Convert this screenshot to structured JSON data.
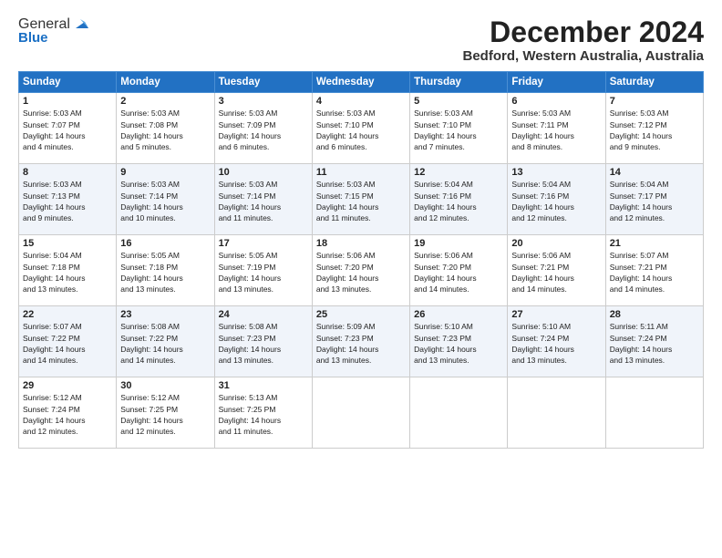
{
  "logo": {
    "general": "General",
    "blue": "Blue"
  },
  "title": "December 2024",
  "location": "Bedford, Western Australia, Australia",
  "headers": [
    "Sunday",
    "Monday",
    "Tuesday",
    "Wednesday",
    "Thursday",
    "Friday",
    "Saturday"
  ],
  "weeks": [
    [
      {
        "day": "1",
        "info": "Sunrise: 5:03 AM\nSunset: 7:07 PM\nDaylight: 14 hours\nand 4 minutes."
      },
      {
        "day": "2",
        "info": "Sunrise: 5:03 AM\nSunset: 7:08 PM\nDaylight: 14 hours\nand 5 minutes."
      },
      {
        "day": "3",
        "info": "Sunrise: 5:03 AM\nSunset: 7:09 PM\nDaylight: 14 hours\nand 6 minutes."
      },
      {
        "day": "4",
        "info": "Sunrise: 5:03 AM\nSunset: 7:10 PM\nDaylight: 14 hours\nand 6 minutes."
      },
      {
        "day": "5",
        "info": "Sunrise: 5:03 AM\nSunset: 7:10 PM\nDaylight: 14 hours\nand 7 minutes."
      },
      {
        "day": "6",
        "info": "Sunrise: 5:03 AM\nSunset: 7:11 PM\nDaylight: 14 hours\nand 8 minutes."
      },
      {
        "day": "7",
        "info": "Sunrise: 5:03 AM\nSunset: 7:12 PM\nDaylight: 14 hours\nand 9 minutes."
      }
    ],
    [
      {
        "day": "8",
        "info": "Sunrise: 5:03 AM\nSunset: 7:13 PM\nDaylight: 14 hours\nand 9 minutes."
      },
      {
        "day": "9",
        "info": "Sunrise: 5:03 AM\nSunset: 7:14 PM\nDaylight: 14 hours\nand 10 minutes."
      },
      {
        "day": "10",
        "info": "Sunrise: 5:03 AM\nSunset: 7:14 PM\nDaylight: 14 hours\nand 11 minutes."
      },
      {
        "day": "11",
        "info": "Sunrise: 5:03 AM\nSunset: 7:15 PM\nDaylight: 14 hours\nand 11 minutes."
      },
      {
        "day": "12",
        "info": "Sunrise: 5:04 AM\nSunset: 7:16 PM\nDaylight: 14 hours\nand 12 minutes."
      },
      {
        "day": "13",
        "info": "Sunrise: 5:04 AM\nSunset: 7:16 PM\nDaylight: 14 hours\nand 12 minutes."
      },
      {
        "day": "14",
        "info": "Sunrise: 5:04 AM\nSunset: 7:17 PM\nDaylight: 14 hours\nand 12 minutes."
      }
    ],
    [
      {
        "day": "15",
        "info": "Sunrise: 5:04 AM\nSunset: 7:18 PM\nDaylight: 14 hours\nand 13 minutes."
      },
      {
        "day": "16",
        "info": "Sunrise: 5:05 AM\nSunset: 7:18 PM\nDaylight: 14 hours\nand 13 minutes."
      },
      {
        "day": "17",
        "info": "Sunrise: 5:05 AM\nSunset: 7:19 PM\nDaylight: 14 hours\nand 13 minutes."
      },
      {
        "day": "18",
        "info": "Sunrise: 5:06 AM\nSunset: 7:20 PM\nDaylight: 14 hours\nand 13 minutes."
      },
      {
        "day": "19",
        "info": "Sunrise: 5:06 AM\nSunset: 7:20 PM\nDaylight: 14 hours\nand 14 minutes."
      },
      {
        "day": "20",
        "info": "Sunrise: 5:06 AM\nSunset: 7:21 PM\nDaylight: 14 hours\nand 14 minutes."
      },
      {
        "day": "21",
        "info": "Sunrise: 5:07 AM\nSunset: 7:21 PM\nDaylight: 14 hours\nand 14 minutes."
      }
    ],
    [
      {
        "day": "22",
        "info": "Sunrise: 5:07 AM\nSunset: 7:22 PM\nDaylight: 14 hours\nand 14 minutes."
      },
      {
        "day": "23",
        "info": "Sunrise: 5:08 AM\nSunset: 7:22 PM\nDaylight: 14 hours\nand 14 minutes."
      },
      {
        "day": "24",
        "info": "Sunrise: 5:08 AM\nSunset: 7:23 PM\nDaylight: 14 hours\nand 13 minutes."
      },
      {
        "day": "25",
        "info": "Sunrise: 5:09 AM\nSunset: 7:23 PM\nDaylight: 14 hours\nand 13 minutes."
      },
      {
        "day": "26",
        "info": "Sunrise: 5:10 AM\nSunset: 7:23 PM\nDaylight: 14 hours\nand 13 minutes."
      },
      {
        "day": "27",
        "info": "Sunrise: 5:10 AM\nSunset: 7:24 PM\nDaylight: 14 hours\nand 13 minutes."
      },
      {
        "day": "28",
        "info": "Sunrise: 5:11 AM\nSunset: 7:24 PM\nDaylight: 14 hours\nand 13 minutes."
      }
    ],
    [
      {
        "day": "29",
        "info": "Sunrise: 5:12 AM\nSunset: 7:24 PM\nDaylight: 14 hours\nand 12 minutes."
      },
      {
        "day": "30",
        "info": "Sunrise: 5:12 AM\nSunset: 7:25 PM\nDaylight: 14 hours\nand 12 minutes."
      },
      {
        "day": "31",
        "info": "Sunrise: 5:13 AM\nSunset: 7:25 PM\nDaylight: 14 hours\nand 11 minutes."
      },
      {
        "day": "",
        "info": ""
      },
      {
        "day": "",
        "info": ""
      },
      {
        "day": "",
        "info": ""
      },
      {
        "day": "",
        "info": ""
      }
    ]
  ]
}
